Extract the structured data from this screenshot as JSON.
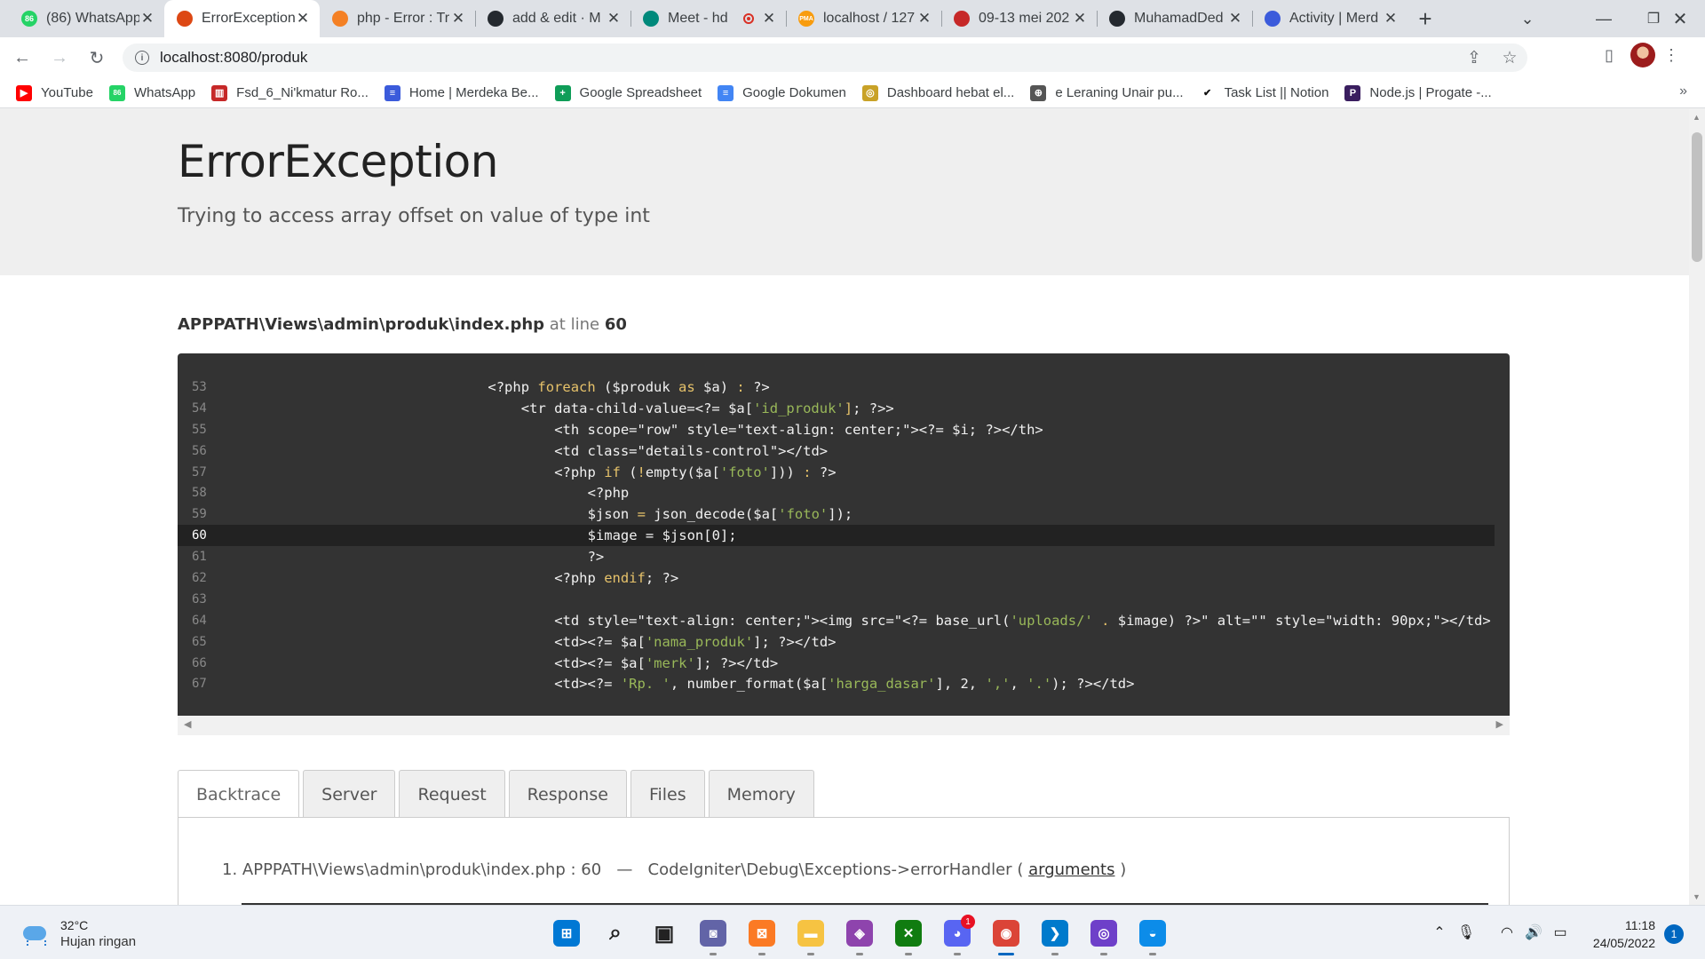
{
  "browser": {
    "tabs": [
      {
        "title": "(86) WhatsApp",
        "icon": "whatsapp-icon",
        "fav_text": "86",
        "color": "#25d366",
        "active": false
      },
      {
        "title": "ErrorException",
        "icon": "flame-icon",
        "fav_text": "",
        "color": "#dd4814",
        "active": true
      },
      {
        "title": "php - Error : Tr",
        "icon": "stackoverflow-icon",
        "fav_text": "",
        "color": "#f48024",
        "active": false
      },
      {
        "title": "add & edit · M",
        "icon": "github-icon",
        "fav_text": "",
        "color": "#24292f",
        "active": false
      },
      {
        "title": "Meet - hd",
        "icon": "meet-icon",
        "fav_text": "",
        "color": "#00897b",
        "active": false,
        "recording": true
      },
      {
        "title": "localhost / 127",
        "icon": "phpmyadmin-icon",
        "fav_text": "PMA",
        "color": "#f89c0e",
        "active": false
      },
      {
        "title": "09-13 mei 202",
        "icon": "trello-icon",
        "fav_text": "",
        "color": "#c62828",
        "active": false
      },
      {
        "title": "MuhamadDed",
        "icon": "github-icon",
        "fav_text": "",
        "color": "#24292f",
        "active": false
      },
      {
        "title": "Activity | Merd",
        "icon": "merdeka-icon",
        "fav_text": "",
        "color": "#3b5bdb",
        "active": false
      }
    ],
    "url": "localhost:8080/produk",
    "bookmarks": [
      {
        "label": "YouTube",
        "icon": "youtube-icon",
        "color": "#ff0000",
        "glyph": "▶"
      },
      {
        "label": "WhatsApp",
        "icon": "whatsapp-icon",
        "color": "#25d366",
        "glyph": "86"
      },
      {
        "label": "Fsd_6_Ni'kmatur Ro...",
        "icon": "trello-icon",
        "color": "#c62828",
        "glyph": "▥"
      },
      {
        "label": "Home | Merdeka Be...",
        "icon": "merdeka-icon",
        "color": "#3b5bdb",
        "glyph": "≡"
      },
      {
        "label": "Google Spreadsheet",
        "icon": "sheets-icon",
        "color": "#0f9d58",
        "glyph": "+"
      },
      {
        "label": "Google Dokumen",
        "icon": "docs-icon",
        "color": "#4285f4",
        "glyph": "≡"
      },
      {
        "label": "Dashboard hebat el...",
        "icon": "globe-icon",
        "color": "#c9a227",
        "glyph": "◎"
      },
      {
        "label": "e Leraning Unair pu...",
        "icon": "globe-icon",
        "color": "#555555",
        "glyph": "⊕"
      },
      {
        "label": "Task List || Notion",
        "icon": "check-icon",
        "color": "#ffffff",
        "glyph": "✔"
      },
      {
        "label": "Node.js | Progate -...",
        "icon": "progate-icon",
        "color": "#3a1e5f",
        "glyph": "P"
      }
    ]
  },
  "error": {
    "title": "ErrorException",
    "message": "Trying to access array offset on value of type int",
    "file": "APPPATH\\Views\\admin\\produk\\index.php",
    "at_text": "at line",
    "line": "60"
  },
  "code_lines": [
    {
      "n": "53",
      "indent": 24,
      "parts": [
        [
          "t",
          "<?php "
        ],
        [
          "k",
          "foreach"
        ],
        [
          "t",
          " ($produk "
        ],
        [
          "k",
          "as"
        ],
        [
          "t",
          " $a) "
        ],
        [
          "k",
          ":"
        ],
        [
          "t",
          " ?>"
        ]
      ]
    },
    {
      "n": "54",
      "indent": 28,
      "parts": [
        [
          "t",
          "<tr data-child-value=<?= $a["
        ],
        [
          "s",
          "'id_produk'"
        ],
        [
          "k",
          "]"
        ],
        [
          "t",
          "; ?>>"
        ]
      ]
    },
    {
      "n": "55",
      "indent": 32,
      "parts": [
        [
          "t",
          "<th scope=\"row\" style=\"text-align: center;\"><?= $i; ?></th>"
        ]
      ]
    },
    {
      "n": "56",
      "indent": 32,
      "parts": [
        [
          "t",
          "<td class=\"details-control\"></td>"
        ]
      ]
    },
    {
      "n": "57",
      "indent": 32,
      "parts": [
        [
          "t",
          "<?php "
        ],
        [
          "k",
          "if"
        ],
        [
          "t",
          " ("
        ],
        [
          "k",
          "!"
        ],
        [
          "t",
          "empty($a["
        ],
        [
          "s",
          "'foto'"
        ],
        [
          "t",
          "])) "
        ],
        [
          "k",
          ":"
        ],
        [
          "t",
          " ?>"
        ]
      ]
    },
    {
      "n": "58",
      "indent": 36,
      "parts": [
        [
          "t",
          "<?php"
        ]
      ]
    },
    {
      "n": "59",
      "indent": 36,
      "parts": [
        [
          "t",
          "$json "
        ],
        [
          "k",
          "="
        ],
        [
          "t",
          " json_decode($a["
        ],
        [
          "s",
          "'foto'"
        ],
        [
          "t",
          "]);"
        ]
      ]
    },
    {
      "n": "60",
      "indent": 36,
      "parts": [
        [
          "t",
          "$image = $json[0];"
        ]
      ],
      "highlight": true
    },
    {
      "n": "61",
      "indent": 36,
      "parts": [
        [
          "t",
          "?>"
        ]
      ]
    },
    {
      "n": "62",
      "indent": 32,
      "parts": [
        [
          "t",
          "<?php "
        ],
        [
          "k",
          "endif"
        ],
        [
          "t",
          "; ?>"
        ]
      ]
    },
    {
      "n": "63",
      "indent": 0,
      "parts": [
        [
          "t",
          ""
        ]
      ]
    },
    {
      "n": "64",
      "indent": 32,
      "parts": [
        [
          "t",
          "<td style=\"text-align: center;\"><img src=\"<?= base_url("
        ],
        [
          "s",
          "'uploads/'"
        ],
        [
          "t",
          " "
        ],
        [
          "k",
          "."
        ],
        [
          "t",
          " $image) ?>\" alt=\"\" style=\"width: 90px;\"></td>"
        ]
      ]
    },
    {
      "n": "65",
      "indent": 32,
      "parts": [
        [
          "t",
          "<td><?= $a["
        ],
        [
          "s",
          "'nama_produk'"
        ],
        [
          "t",
          "]; ?></td>"
        ]
      ]
    },
    {
      "n": "66",
      "indent": 32,
      "parts": [
        [
          "t",
          "<td><?= $a["
        ],
        [
          "s",
          "'merk'"
        ],
        [
          "t",
          "]; ?></td>"
        ]
      ]
    },
    {
      "n": "67",
      "indent": 32,
      "parts": [
        [
          "t",
          "<td><?= "
        ],
        [
          "s",
          "'Rp. '"
        ],
        [
          "t",
          ", number_format($a["
        ],
        [
          "s",
          "'harga_dasar'"
        ],
        [
          "t",
          "], 2, "
        ],
        [
          "s",
          "','"
        ],
        [
          "t",
          ", "
        ],
        [
          "s",
          "'.'"
        ],
        [
          "t",
          "); ?></td>"
        ]
      ]
    }
  ],
  "debug_tabs": [
    "Backtrace",
    "Server",
    "Request",
    "Response",
    "Files",
    "Memory"
  ],
  "backtrace": {
    "item": "1. APPPATH\\Views\\admin\\produk\\index.php : 60",
    "sep": "—",
    "handler": "CodeIgniter\\Debug\\Exceptions->errorHandler",
    "open": "(",
    "link": "arguments",
    "close": ")"
  },
  "taskbar": {
    "temperature": "32°C",
    "weather": "Hujan ringan",
    "time": "11:18",
    "date": "24/05/2022",
    "notifications": "1",
    "apps": [
      {
        "name": "windows-start-icon",
        "color": "#0078d4",
        "glyph": "⊞"
      },
      {
        "name": "search-icon",
        "color": "#eef1f6",
        "glyph": "⌕"
      },
      {
        "name": "task-view-icon",
        "color": "#eef1f6",
        "glyph": "▣"
      },
      {
        "name": "chat-icon",
        "color": "#6264a7",
        "glyph": "◙"
      },
      {
        "name": "xampp-icon",
        "color": "#fb7a24",
        "glyph": "⊠"
      },
      {
        "name": "file-explorer-icon",
        "color": "#f6c342",
        "glyph": "▬"
      },
      {
        "name": "photo-app-icon",
        "color": "#8e44ad",
        "glyph": "◈"
      },
      {
        "name": "xbox-icon",
        "color": "#107c10",
        "glyph": "✕"
      },
      {
        "name": "discord-icon",
        "color": "#5865f2",
        "glyph": "◕",
        "badge": "1"
      },
      {
        "name": "chrome-icon",
        "color": "#db4437",
        "glyph": "◉",
        "active": true
      },
      {
        "name": "vscode-icon",
        "color": "#007acc",
        "glyph": "❯"
      },
      {
        "name": "github-desktop-icon",
        "color": "#6e40c9",
        "glyph": "◎"
      },
      {
        "name": "edge-icon",
        "color": "#0c8ce9",
        "glyph": "◒"
      }
    ]
  }
}
